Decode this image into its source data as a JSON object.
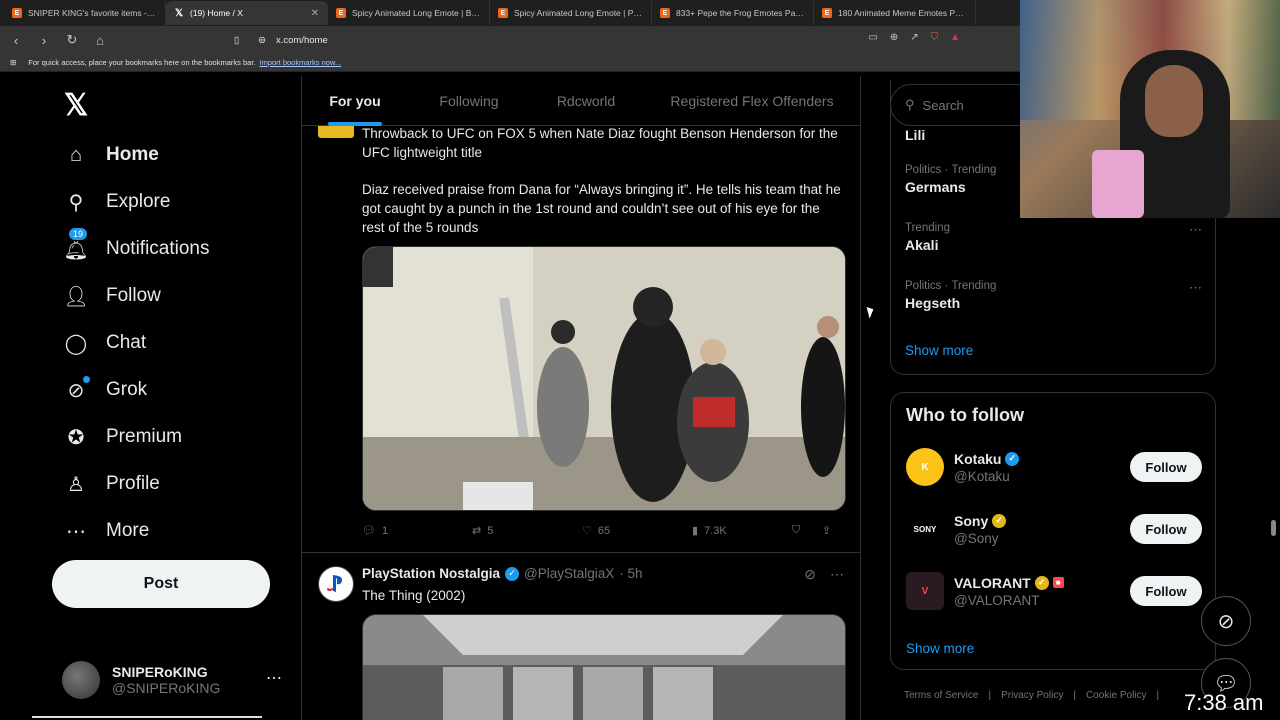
{
  "browser": {
    "tabs": [
      {
        "title": "SNIPER KING's favorite items - Etsy",
        "icon": "etsy-icon"
      },
      {
        "title": "(19) Home / X",
        "icon": "x-icon"
      },
      {
        "title": "Spicy Animated Long Emote | Blue H",
        "icon": "etsy-icon"
      },
      {
        "title": "Spicy Animated Long Emote | Purple",
        "icon": "etsy-icon"
      },
      {
        "title": "833+ Pepe the Frog Emotes Pack - A",
        "icon": "etsy-icon"
      },
      {
        "title": "180 Animated Meme Emotes Pack: T",
        "icon": "etsy-icon"
      }
    ],
    "url": "x.com/home",
    "bookmarks_prompt": "For quick access, place your bookmarks here on the bookmarks bar.",
    "import_link": "Import bookmarks now..."
  },
  "nav": {
    "items": [
      {
        "label": "Home",
        "icon": "home-icon"
      },
      {
        "label": "Explore",
        "icon": "search-icon"
      },
      {
        "label": "Notifications",
        "icon": "bell-icon",
        "badge": "19"
      },
      {
        "label": "Follow",
        "icon": "add-person-icon"
      },
      {
        "label": "Chat",
        "icon": "chat-icon"
      },
      {
        "label": "Grok",
        "icon": "grok-icon"
      },
      {
        "label": "Premium",
        "icon": "premium-icon"
      },
      {
        "label": "Profile",
        "icon": "person-icon"
      },
      {
        "label": "More",
        "icon": "more-icon"
      }
    ],
    "post_label": "Post",
    "account": {
      "name": "SNIPERoKING",
      "handle": "@SNIPERoKING"
    }
  },
  "feed": {
    "tabs": [
      "For you",
      "Following",
      "Rdcworld",
      "Registered Flex Offenders"
    ],
    "tweet1": {
      "line1": "Throwback to UFC on FOX 5 when Nate Diaz fought Benson Henderson for the UFC lightweight title",
      "line2": "Diaz received praise from Dana for “Always bringing it”. He tells his team that he got caught by a punch in the 1st round and couldn’t see out of his eye for the rest of the 5 rounds",
      "replies": "1",
      "reposts": "5",
      "likes": "65",
      "views": "7.3K"
    },
    "tweet2": {
      "name": "PlayStation Nostalgia",
      "handle": "@PlayStalgiaX",
      "time": "· 5h",
      "text": "The Thing (2002)"
    }
  },
  "right": {
    "search_placeholder": "Search",
    "trends": [
      {
        "category": "",
        "topic": "Lili"
      },
      {
        "category": "Politics · Trending",
        "topic": "Germans"
      },
      {
        "category": "Trending",
        "topic": "Akali"
      },
      {
        "category": "Politics · Trending",
        "topic": "Hegseth"
      }
    ],
    "show_more": "Show more",
    "who_to_follow_title": "Who to follow",
    "who_to_follow": [
      {
        "name": "Kotaku",
        "handle": "@Kotaku",
        "verified": "blue"
      },
      {
        "name": "Sony",
        "handle": "@Sony",
        "verified": "gold"
      },
      {
        "name": "VALORANT",
        "handle": "@VALORANT",
        "verified": "gold"
      }
    ],
    "follow_label": "Follow",
    "footer": [
      "Terms of Service",
      "Privacy Policy",
      "Cookie Policy"
    ]
  },
  "overlay": {
    "clock": "7:38 am"
  }
}
